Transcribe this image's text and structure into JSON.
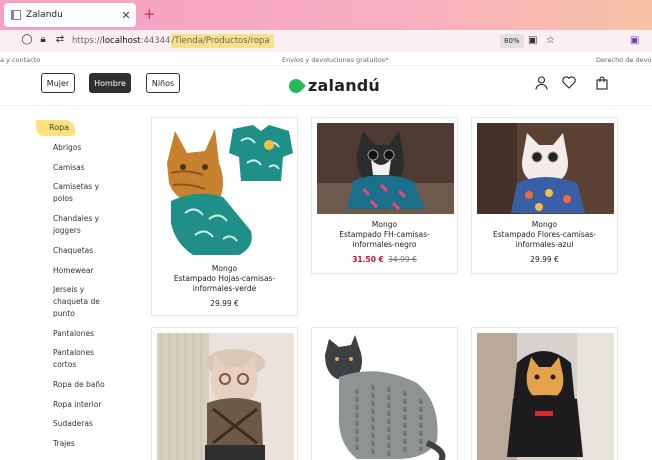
{
  "browser": {
    "tab_title": "Zalandu",
    "new_tab": "+",
    "url_prefix": "https://",
    "url_host": "localhost",
    "url_port": ":44344",
    "url_path": "/Tienda/Productos/ropa",
    "zoom": "80%"
  },
  "topbar": {
    "left_text": "a y contacto",
    "center_text": "Envíos y devoluciones gratuitos*",
    "right_text": "Derecho de devolu"
  },
  "header": {
    "genders": [
      "Mujer",
      "Hombre",
      "Niños"
    ],
    "active_gender": "Hombre",
    "logo": "zalandú"
  },
  "sidebar": {
    "title": "Ropa",
    "items": [
      "Abrigos",
      "Camisas",
      "Camisetas y polos",
      "Chandales y joggers",
      "Chaquetas",
      "Homewear",
      "Jerseis y chaqueta de punto",
      "Pantalones",
      "Pantalones cortos",
      "Ropa de baño",
      "Ropa interior",
      "Sudaderas",
      "Trajes"
    ]
  },
  "products": [
    {
      "brand": "Mongo",
      "name": "Estampado Hojas-camisas-informales-verde",
      "price": "29.99 €"
    },
    {
      "brand": "Mongo",
      "name": "Estampado FH-camisas-informales-negro",
      "sale_price": "31.50 €",
      "old_price": "34.99 €"
    },
    {
      "brand": "Mongo",
      "name": "Estampado Flores-camisas-informales-azul",
      "price": "29.99 €"
    },
    {
      "brand": "",
      "name": "",
      "price": ""
    },
    {
      "brand": "",
      "name": "",
      "price": ""
    },
    {
      "brand": "",
      "name": "",
      "price": ""
    }
  ],
  "colors": {
    "accent_green": "#27ba5a",
    "sale_red": "#c8102e",
    "highlight_yellow": "#fbe27a"
  }
}
